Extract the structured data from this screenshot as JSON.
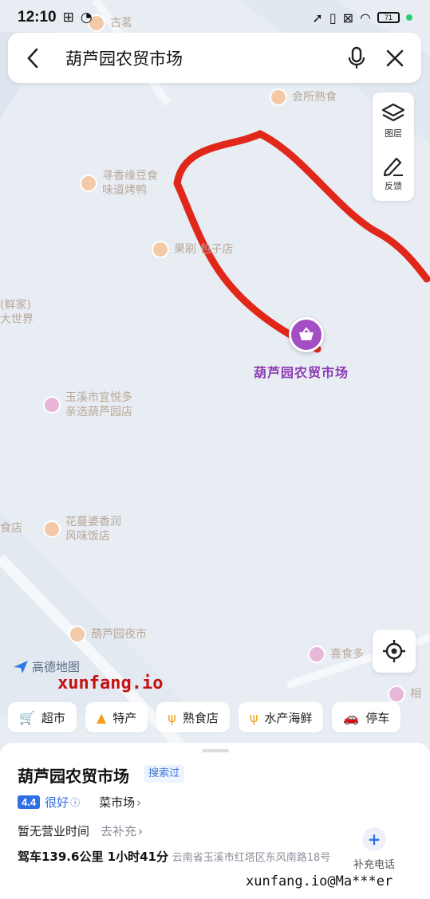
{
  "status_bar": {
    "time": "12:10",
    "battery": "71"
  },
  "search": {
    "query": "葫芦园农贸市场"
  },
  "tools": {
    "layers_label": "图层",
    "feedback_label": "反馈"
  },
  "map": {
    "pois": [
      {
        "text": "古茗"
      },
      {
        "text": "会所熟食"
      },
      {
        "text": "寻香缘豆食 味道烤鸭"
      },
      {
        "text": "果刷 包子店"
      },
      {
        "text": "(鲜家) 大世界"
      },
      {
        "text": "玉溪市宜悦多 亲选葫芦园店"
      },
      {
        "text": "花蔓婆香润 风味饭店"
      },
      {
        "text": "食店"
      },
      {
        "text": "葫芦园夜市"
      },
      {
        "text": "喜食多"
      },
      {
        "text": "相"
      }
    ],
    "marker_label": "葫芦园农贸市场",
    "logo_text": "高德地图"
  },
  "watermark_top": "xunfang.io",
  "watermark_bottom": "xunfang.io@Ma***er",
  "chips": [
    {
      "icon": "cart-icon",
      "label": "超市"
    },
    {
      "icon": "bag-icon",
      "label": "特产"
    },
    {
      "icon": "utensils-icon",
      "label": "熟食店"
    },
    {
      "icon": "utensils-icon",
      "label": "水产海鲜"
    },
    {
      "icon": "car-icon",
      "label": "停车"
    }
  ],
  "place": {
    "name": "葫芦园农贸市场",
    "searched_tag": "搜索过",
    "rating": "4.4",
    "rating_word": "很好",
    "category": "菜市场",
    "hours": "暂无营业时间",
    "hours_action": "去补充",
    "drive_info": "驾车139.6公里  1小时41分",
    "address": "云南省玉溪市红塔区东风南路18号",
    "phone_action": "补充电话"
  },
  "colors": {
    "route_red": "#e0271a",
    "marker_purple": "#a44ec4",
    "accent_blue": "#2f6fe4"
  }
}
